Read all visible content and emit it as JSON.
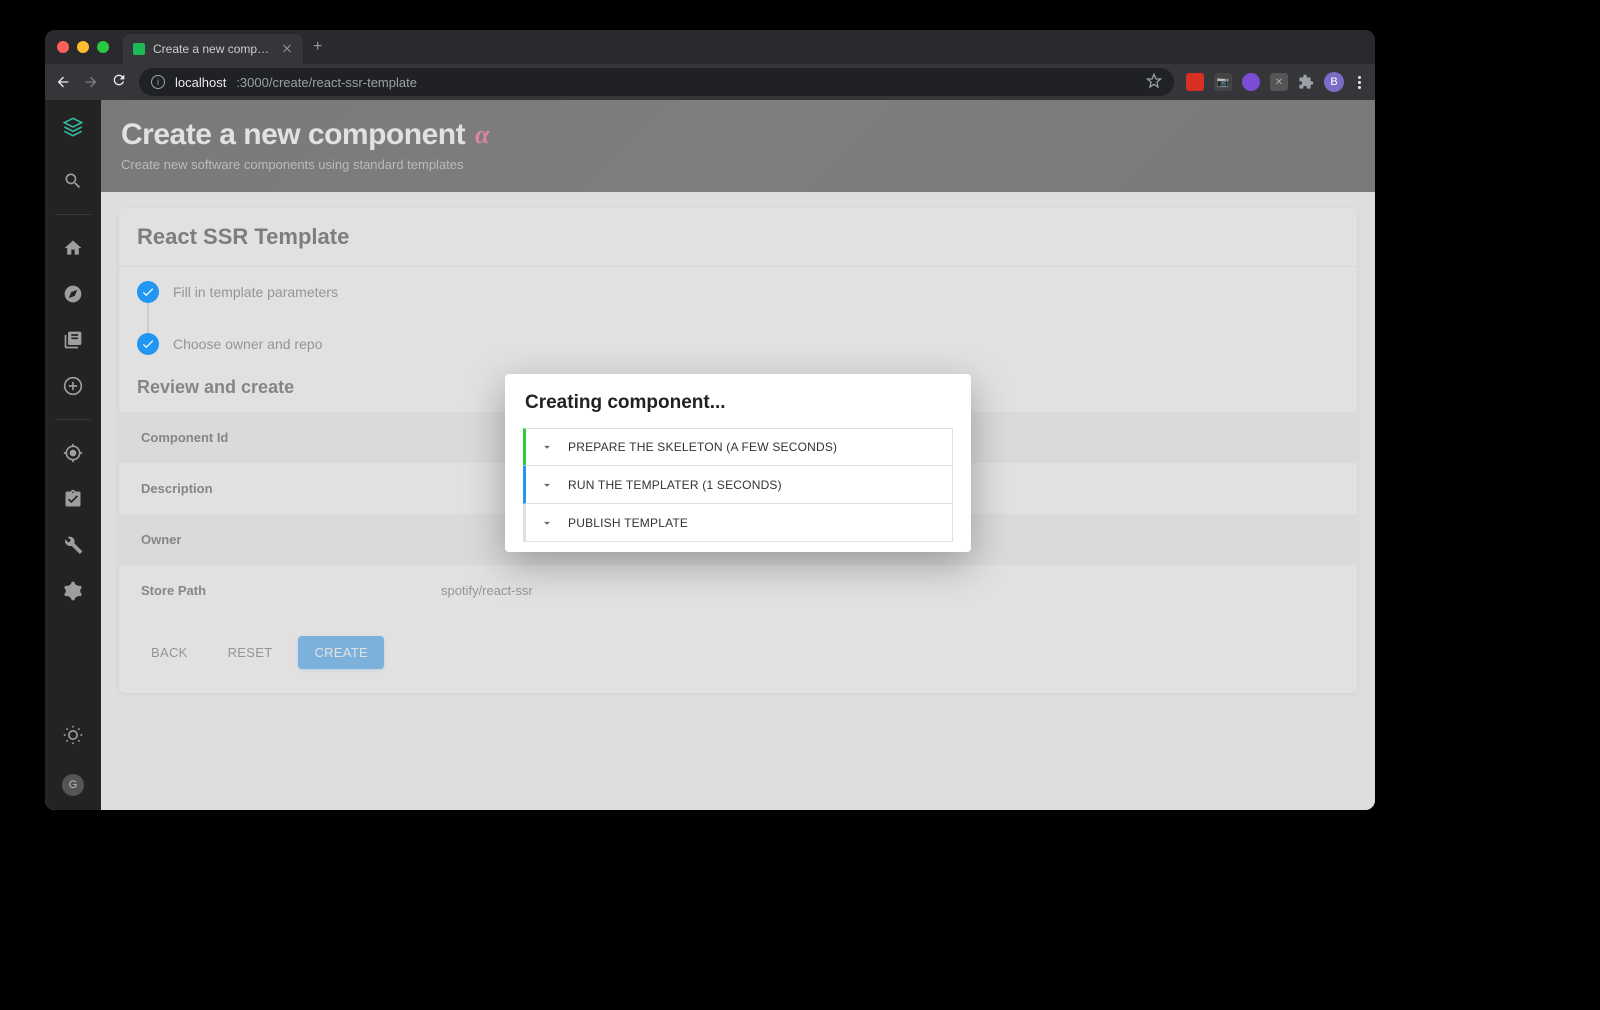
{
  "browser": {
    "tab_title": "Create a new component | Bac",
    "url_host": "localhost",
    "url_path": ":3000/create/react-ssr-template",
    "profile_initial": "B"
  },
  "header": {
    "title": "Create a new component",
    "alpha": "α",
    "subtitle": "Create new software components using standard templates"
  },
  "card": {
    "title": "React SSR Template"
  },
  "stepper": {
    "step1": "Fill in template parameters",
    "step2": "Choose owner and repo"
  },
  "review": {
    "title": "Review and create",
    "rows": {
      "component_id_label": "Component Id",
      "component_id_value": "",
      "description_label": "Description",
      "description_value": "",
      "owner_label": "Owner",
      "owner_value": "",
      "store_path_label": "Store Path",
      "store_path_value": "spotify/react-ssr"
    }
  },
  "actions": {
    "back": "BACK",
    "reset": "RESET",
    "create": "CREATE"
  },
  "modal": {
    "title": "Creating component...",
    "step1": "PREPARE THE SKELETON (A FEW SECONDS)",
    "step2": "RUN THE TEMPLATER (1 SECONDS)",
    "step3": "PUBLISH TEMPLATE"
  },
  "sidebar": {
    "avatar": "G"
  }
}
